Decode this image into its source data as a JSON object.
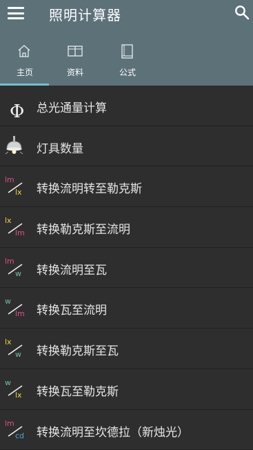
{
  "app": {
    "title": "照明计算器"
  },
  "tabs": [
    {
      "label": "主页",
      "icon": "home-icon"
    },
    {
      "label": "资料",
      "icon": "book-open-icon"
    },
    {
      "label": "公式",
      "icon": "book-icon"
    }
  ],
  "colors": {
    "header": "#5d7179",
    "indicator": "#6fc2cf",
    "pink": "#e0508a",
    "yellow": "#f3d53d",
    "green": "#6fbfa0",
    "blue": "#4aa8d8"
  },
  "items": [
    {
      "label": "总光通量计算",
      "icon": "phi-icon",
      "top": "",
      "bottom": ""
    },
    {
      "label": "灯具数量",
      "icon": "lamp-icon",
      "top": "",
      "bottom": ""
    },
    {
      "label": "转换流明转至勒克斯",
      "icon": "lm-lx-icon",
      "top": "lm",
      "bottom": "lx"
    },
    {
      "label": "转换勒克斯至流明",
      "icon": "lx-lm-icon",
      "top": "lx",
      "bottom": "lm"
    },
    {
      "label": "转换流明至瓦",
      "icon": "lm-w-icon",
      "top": "lm",
      "bottom": "w"
    },
    {
      "label": "转换瓦至流明",
      "icon": "w-lm-icon",
      "top": "w",
      "bottom": "lm"
    },
    {
      "label": "转换勒克斯至瓦",
      "icon": "lx-w-icon",
      "top": "lx",
      "bottom": "w"
    },
    {
      "label": "转换瓦至勒克斯",
      "icon": "w-lx-icon",
      "top": "w",
      "bottom": "lx"
    },
    {
      "label": "转换流明至坎德拉（新烛光）",
      "icon": "lm-cd-icon",
      "top": "lm",
      "bottom": "cd"
    }
  ]
}
